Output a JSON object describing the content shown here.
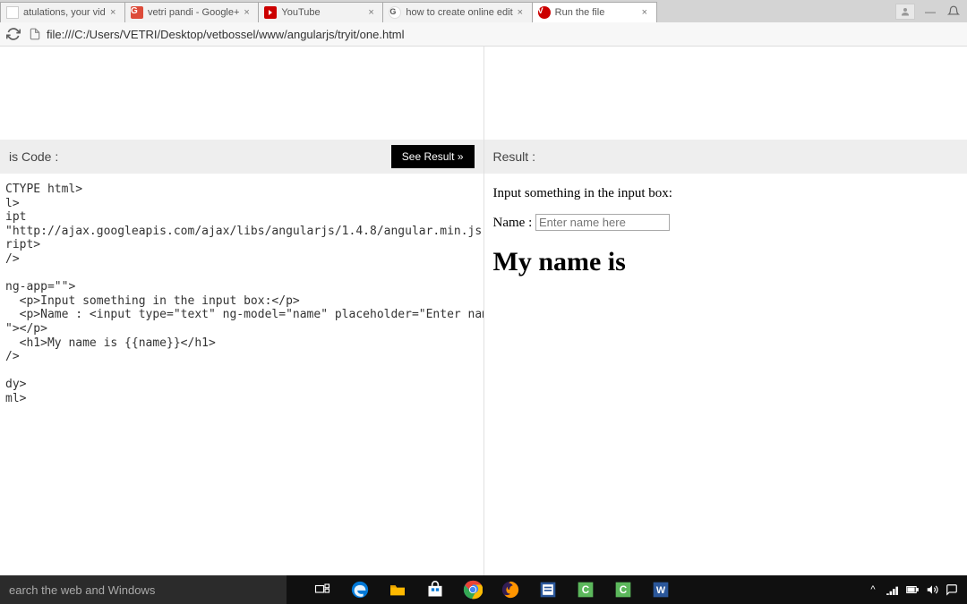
{
  "tabs": [
    {
      "title": "atulations, your vid",
      "favicon": "generic"
    },
    {
      "title": "vetri pandi - Google+",
      "favicon": "gplus"
    },
    {
      "title": "YouTube",
      "favicon": "youtube"
    },
    {
      "title": "how to create online edit",
      "favicon": "google"
    },
    {
      "title": "Run the file",
      "favicon": "v",
      "active": true
    }
  ],
  "url": "file:///C:/Users/VETRI/Desktop/vetbossel/www/angularjs/tryit/one.html",
  "editor": {
    "code_header": "is Code :",
    "see_result": "See Result »",
    "result_header": "Result :",
    "code": "CTYPE html>\nl>\nipt\n\"http://ajax.googleapis.com/ajax/libs/angularjs/1.4.8/angular.min.js\">\nript>\n/>\n\nng-app=\"\">\n  <p>Input something in the input box:</p>\n  <p>Name : <input type=\"text\" ng-model=\"name\" placeholder=\"Enter name\n\"></p>\n  <h1>My name is {{name}}</h1>\n/>\n\ndy>\nml>"
  },
  "result": {
    "prompt": "Input something in the input box:",
    "name_label": "Name :",
    "placeholder": "Enter name here",
    "heading": "My name is"
  },
  "taskbar": {
    "search_placeholder": "earch the web and Windows"
  }
}
